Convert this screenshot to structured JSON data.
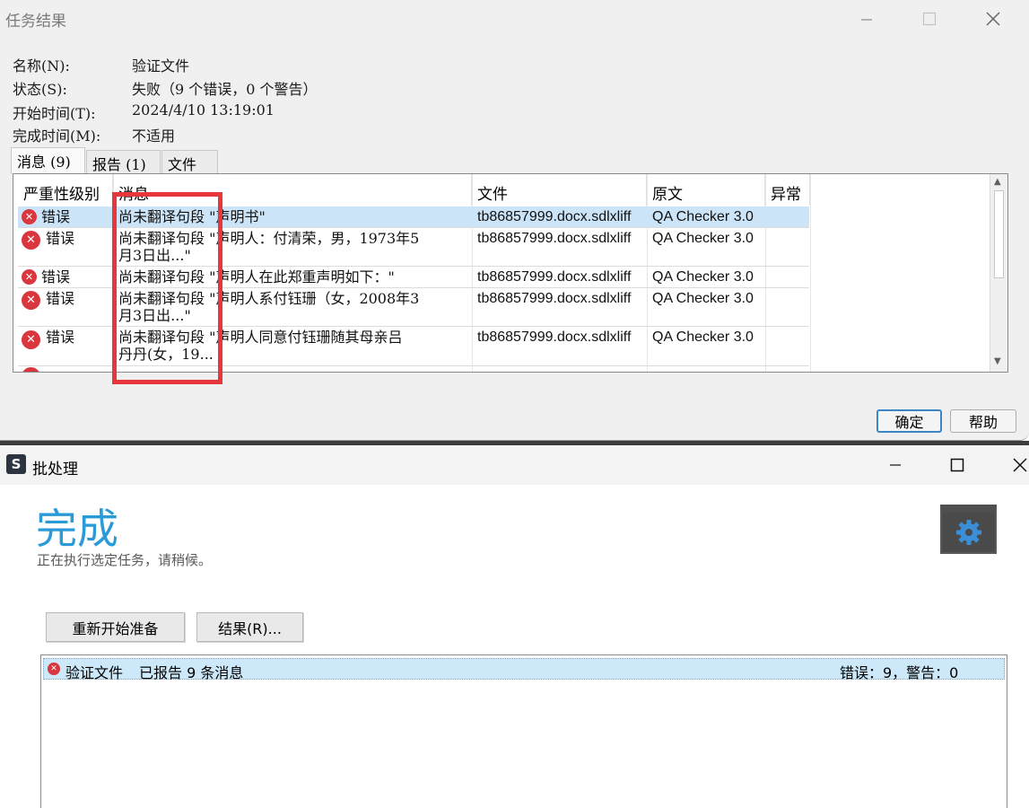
{
  "task_dialog": {
    "title": "任务结果",
    "info": {
      "name_label": "名称(N):",
      "name_value": "验证文件",
      "status_label": "状态(S):",
      "status_value": "失败（9 个错误，0 个警告）",
      "start_label": "开始时间(T):",
      "start_value": "2024/4/10 13:19:01",
      "finish_label": "完成时间(M):",
      "finish_value": "不适用"
    },
    "tabs": [
      {
        "label": "消息 (9)",
        "active": true
      },
      {
        "label": "报告 (1)",
        "active": false
      },
      {
        "label": "文件",
        "active": false
      }
    ],
    "columns": {
      "severity": "严重性级别",
      "message": "消息",
      "file": "文件",
      "origin": "原文",
      "exception": "异常"
    },
    "rows": [
      {
        "severity": "错误",
        "message_line1": "尚未翻译句段 \"声明书\"",
        "message_line2": "",
        "file": "tb86857999.docx.sdlxliff",
        "origin": "QA Checker 3.0",
        "selected": true
      },
      {
        "severity": "错误",
        "message_line1": "尚未翻译句段 \"声明人：付清荣，男，1973年5",
        "message_line2": "月3日出...\"",
        "file": "tb86857999.docx.sdlxliff",
        "origin": "QA Checker 3.0",
        "selected": false
      },
      {
        "severity": "错误",
        "message_line1": "尚未翻译句段 \"声明人在此郑重声明如下：\"",
        "message_line2": "",
        "file": "tb86857999.docx.sdlxliff",
        "origin": "QA Checker 3.0",
        "selected": false
      },
      {
        "severity": "错误",
        "message_line1": "尚未翻译句段 \"声明人系付钰珊（女，2008年3",
        "message_line2": "月3日出...\"",
        "file": "tb86857999.docx.sdlxliff",
        "origin": "QA Checker 3.0",
        "selected": false
      },
      {
        "severity": "错误",
        "message_line1": "尚未翻译句段 \"声明人同意付钰珊随其母亲吕",
        "message_line2": "丹丹(女，19...",
        "file": "tb86857999.docx.sdlxliff",
        "origin": "QA Checker 3.0",
        "selected": false
      }
    ],
    "buttons": {
      "ok": "确定",
      "help": "帮助"
    }
  },
  "batch_window": {
    "title": "批处理",
    "logo_letter": "S",
    "status_heading": "完成",
    "subtitle": "正在执行选定任务，请稍候。",
    "buttons": {
      "restart": "重新开始准备",
      "results": "结果(R)..."
    },
    "result_item": {
      "task": "验证文件",
      "message": "已报告 9 条消息",
      "summary": "错误：9，警告：0"
    }
  },
  "colors": {
    "accent_blue": "#2a9bd7",
    "selection": "#cce4f7",
    "error_red": "#d9363e",
    "highlight_red": "#e8363d"
  }
}
